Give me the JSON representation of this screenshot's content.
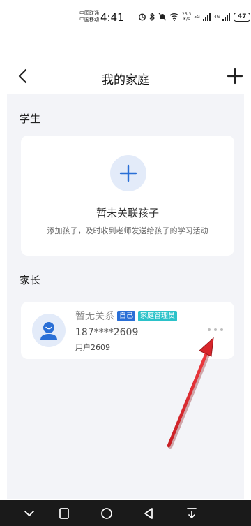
{
  "status_bar": {
    "carrier_1": "中国联通",
    "carrier_2": "中国移动",
    "time": "4:41",
    "speed_value": "25.3",
    "speed_unit": "K/s",
    "net_1": "5G",
    "net_2": "4G",
    "battery": "47"
  },
  "header": {
    "title": "我的家庭"
  },
  "students": {
    "section_label": "学生",
    "empty_title": "暂未关联孩子",
    "empty_desc": "添加孩子，及时收到老师发送给孩子的学习活动"
  },
  "parents": {
    "section_label": "家长",
    "items": [
      {
        "name": "暂无关系",
        "badges": [
          "自己",
          "家庭管理员"
        ],
        "phone": "187****2609",
        "user": "用户2609"
      }
    ]
  },
  "colors": {
    "accent": "#2a6fd6",
    "admin_badge": "#2bc2c9",
    "background": "#f3f4f8",
    "annotation_arrow": "#d8262b"
  }
}
